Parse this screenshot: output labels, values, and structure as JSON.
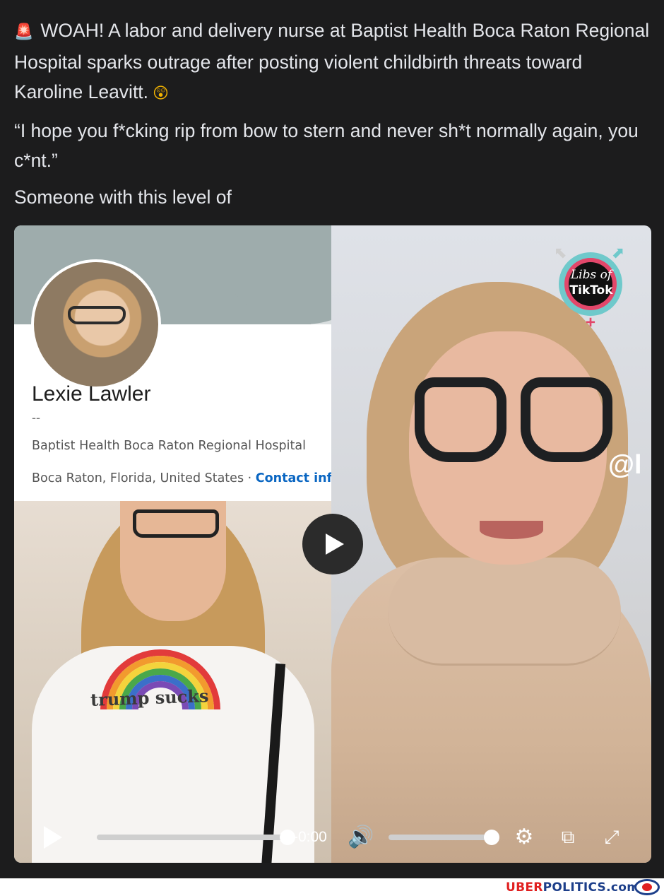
{
  "post": {
    "line1": "WOAH! A labor and delivery nurse at Baptist Health Boca Raton Regional Hospital sparks outrage after posting violent childbirth threats toward Karoline Leavitt.",
    "quote": "“I hope you f*cking rip from bow to stern and never sh*t normally again, you c*nt.”",
    "line3": "Someone with this level of"
  },
  "profile": {
    "name": "Lexie Lawler",
    "headline": "--",
    "organization": "Baptist Health Boca Raton Regional Hospital",
    "location": "Boca Raton, Florida, United States · ",
    "contact_label": "Contact info"
  },
  "photo": {
    "shirt_text": "trump sucks"
  },
  "overlay": {
    "badge_line1": "Libs of",
    "badge_line2": "TikTok",
    "handle": "@l"
  },
  "player": {
    "time": "-0:00",
    "progress": 1.0,
    "volume": 1.0
  },
  "icons": {
    "siren": "siren-icon",
    "shocked": "shocked-face-icon",
    "play": "play-icon",
    "volume": "volume-icon",
    "settings": "gear-icon",
    "popout": "external-link-icon",
    "fullscreen": "fullscreen-icon"
  },
  "colors": {
    "background": "#1c1c1d",
    "text": "#e4e6eb",
    "link": "#0a66c2",
    "brand_red": "#e02020",
    "brand_blue": "#1d3f8a"
  },
  "footer": {
    "brand_part1": "UBER",
    "brand_part2": "POLITICS",
    "brand_part3": ".com"
  }
}
